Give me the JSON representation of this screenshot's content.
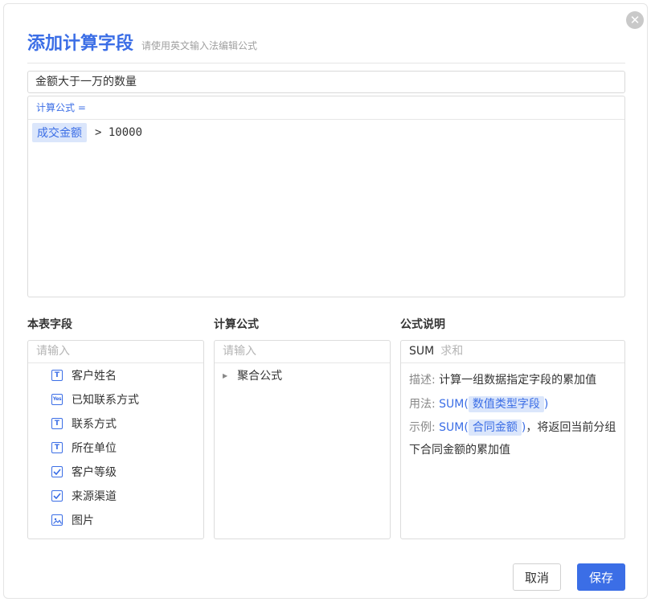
{
  "dialog": {
    "title": "添加计算字段",
    "subtitle": "请使用英文输入法编辑公式",
    "close_symbol": "✕"
  },
  "name_field": {
    "value": "金额大于一万的数量"
  },
  "formula": {
    "label": "计算公式 =",
    "field_token": "成交金额",
    "expression": "> 10000"
  },
  "fields_panel": {
    "title": "本表字段",
    "search_placeholder": "请输入",
    "items": [
      {
        "label": "客户姓名",
        "icon": "text-icon"
      },
      {
        "label": "已知联系方式",
        "icon": "yes-icon"
      },
      {
        "label": "联系方式",
        "icon": "text-icon"
      },
      {
        "label": "所在单位",
        "icon": "text-icon"
      },
      {
        "label": "客户等级",
        "icon": "checkbox-icon"
      },
      {
        "label": "来源渠道",
        "icon": "checkbox-icon"
      },
      {
        "label": "图片",
        "icon": "image-icon"
      }
    ]
  },
  "functions_panel": {
    "title": "计算公式",
    "search_placeholder": "请输入",
    "groups": [
      {
        "label": "聚合公式"
      }
    ]
  },
  "desc_panel": {
    "title": "公式说明",
    "func_name": "SUM",
    "func_sub": "求和",
    "desc_key": "描述:",
    "desc_text": "计算一组数据指定字段的累加值",
    "usage_key": "用法:",
    "usage_func": "SUM(",
    "usage_arg": "数值类型字段",
    "usage_close": ")",
    "example_key": "示例:",
    "example_func": "SUM(",
    "example_arg": "合同金额",
    "example_close": ")",
    "example_text": "，将返回当前分组下合同金额的累加值"
  },
  "buttons": {
    "cancel": "取消",
    "save": "保存"
  },
  "colors": {
    "accent": "#3b6ee6",
    "token_bg": "#dbe6fb"
  }
}
